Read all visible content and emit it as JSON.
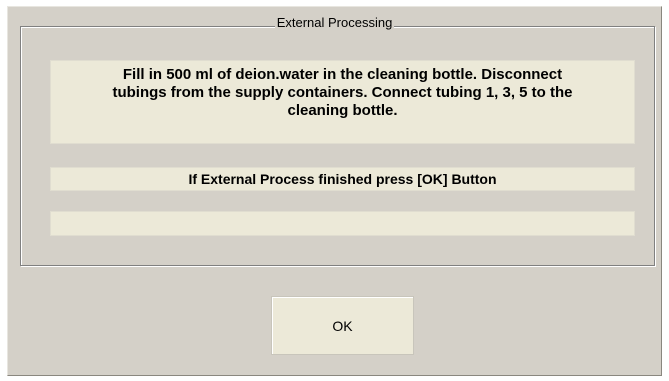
{
  "dialog": {
    "group_title": "External Processing",
    "message": "Fill in 500 ml of deion.water in the cleaning bottle. Disconnect\ntubings from the supply containers. Connect tubing 1, 3,  5 to the\ncleaning bottle.",
    "status": "If External Process finished press [OK] Button",
    "progress": "",
    "ok_label": "OK"
  }
}
